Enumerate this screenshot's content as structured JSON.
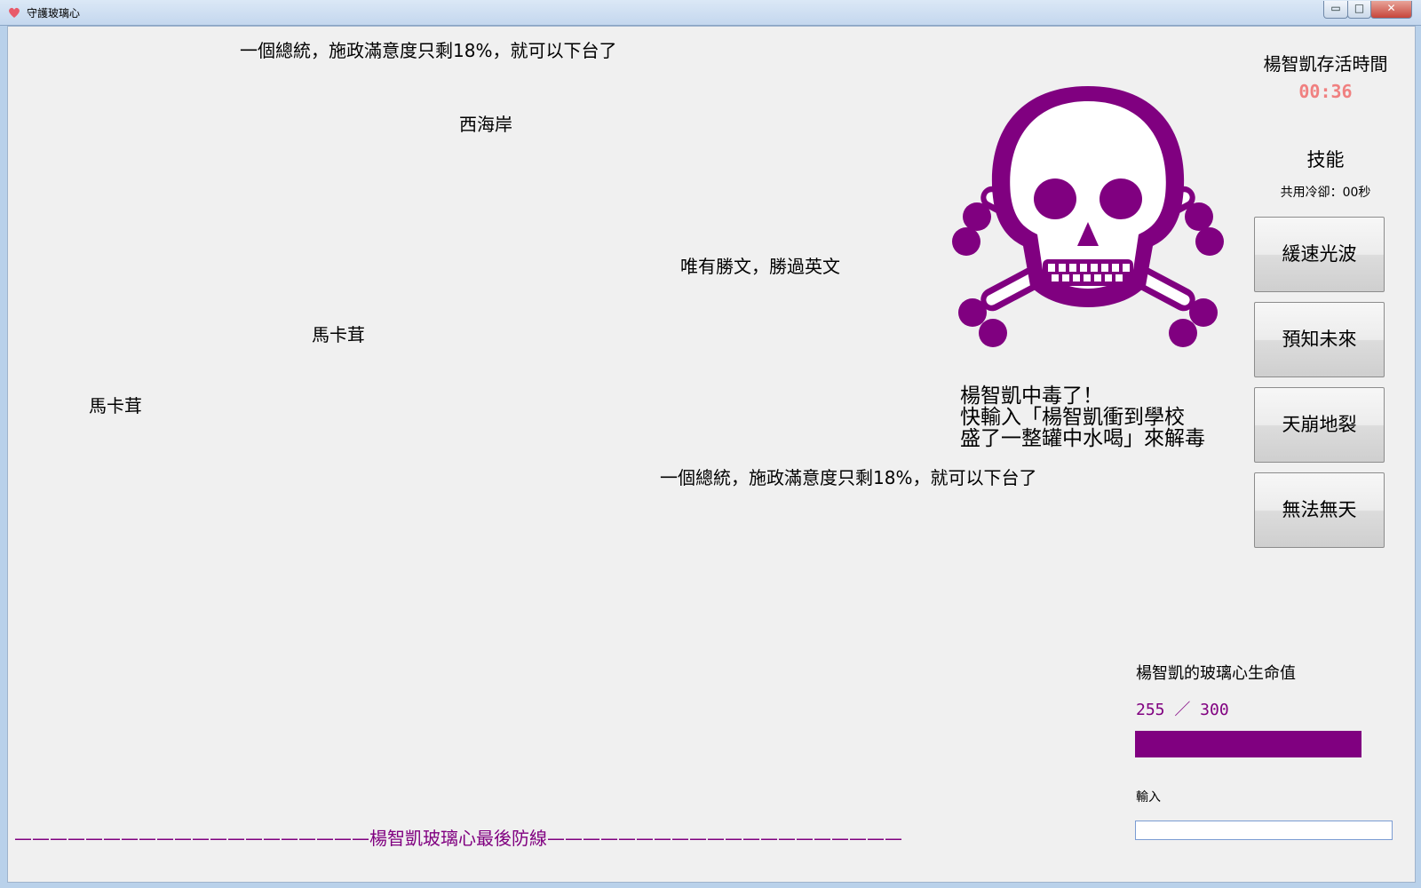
{
  "window": {
    "title": "守護玻璃心",
    "minimize_glyph": "▭",
    "maximize_glyph": "□",
    "close_glyph": "✕"
  },
  "falling_words": [
    "一個總統，施政滿意度只剩18%，就可以下台了",
    "西海岸",
    "唯有勝文，勝過英文",
    "馬卡茸",
    "馬卡茸",
    "一個總統，施政滿意度只剩18%，就可以下台了"
  ],
  "poison": {
    "icon": "skull-crossbones-icon",
    "line1": "楊智凱中毒了！",
    "line2": "快輸入「楊智凱衝到學校",
    "line3": "盛了一整罐中水喝」來解毒"
  },
  "survival": {
    "label": "楊智凱存活時間",
    "time": "00:36"
  },
  "skills": {
    "heading": "技能",
    "cooldown": "共用冷卻：00秒",
    "buttons": [
      "緩速光波",
      "預知未來",
      "天崩地裂",
      "無法無天"
    ]
  },
  "hp": {
    "label": "楊智凱的玻璃心生命值",
    "value_text": "255 ／ 300",
    "fraction": 0.85,
    "color": "#800080"
  },
  "input": {
    "label": "輸入",
    "value": ""
  },
  "defense_line": "————————————————————楊智凱玻璃心最後防線————————————————————"
}
